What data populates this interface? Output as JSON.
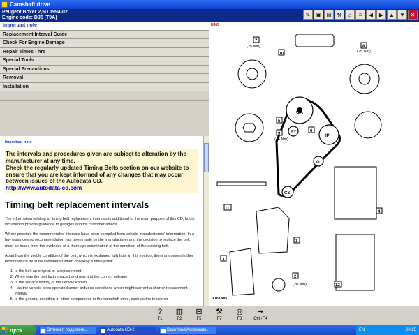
{
  "window": {
    "title": "Camshaft drive"
  },
  "header": {
    "vehicle": "Peugeot   Boxer 2,5D   1994-02",
    "engine": "Engine code: DJ5 (T9A)"
  },
  "toolbar": {
    "icons": [
      "notes-icon",
      "lock-icon",
      "print-icon",
      "tools-icon",
      "home-icon",
      "list-icon",
      "back-icon",
      "forward-icon",
      "up-icon",
      "down-icon",
      "close-icon"
    ]
  },
  "menu": {
    "items": [
      "Important note",
      "Replacement Interval Guide",
      "Check For Engine Damage",
      "Repair Times - hrs",
      "Special Tools",
      "Special Precautions",
      "Removal",
      "Installation"
    ]
  },
  "content": {
    "section_label": "Important note",
    "notice_1": "The intervals and procedures given are subject to alteration by the manufacturer at any time.",
    "notice_2": "Check the regularly updated Timing Belts section on our website to ensure that you are kept informed of any changes that may occur between issues of the Autodata CD.",
    "link": "http://www.autodata-cd.com",
    "heading": "Timing belt replacement intervals",
    "para_1": "The information relating to timing belt replacement intervals is additional to the main purpose of this CD, but is included to provide guidance to garages and for customer advice.",
    "para_2": "Where possible the recommended intervals have been compiled from vehicle manufacturers' information. In a few instances no recommendation has been made by the manufacturer and the decision to replace the belt must be made from the evidence of a thorough examination of the condition of the existing belt.",
    "para_3": "Apart from the visible condition of the belt, which is explained fully later in this section, there are several other factors which must be considered when checking a timing belt:",
    "list": [
      "Is the belt an original or a replacement",
      "When was the belt last replaced and was it at the correct mileage",
      "Is the service history of the vehicle known",
      "Has the vehicle been operated under arduous conditions which might warrant a shorter replacement interval",
      "Is the general condition of other components in the camshaft drive, such as the tensioner"
    ]
  },
  "diagram": {
    "ref_top": "H365",
    "ref_bottom": "AD90985",
    "torque_7": "(25 Nm)",
    "torque_8": "(25 Nm)",
    "torque_9": "(45 Nm)",
    "torque_2": "(20 Nm)",
    "labels": {
      "ca": "CA",
      "bt": "BT",
      "ip": "IP",
      "g": "G",
      "cs": "CS",
      "n1": "1",
      "n2": "2",
      "n3": "3",
      "n4": "4",
      "n5": "5",
      "n6": "6",
      "n7": "7",
      "n8": "8",
      "n9": "9",
      "n10": "10",
      "n11": "11",
      "n12": "12"
    }
  },
  "fkeys": [
    {
      "label": "F1",
      "icon": "help-icon"
    },
    {
      "label": "F2",
      "icon": "book-icon"
    },
    {
      "label": "F5",
      "icon": "open-book-icon"
    },
    {
      "label": "F7",
      "icon": "tools-icon"
    },
    {
      "label": "F8",
      "icon": "belt-icon"
    },
    {
      "label": "Ctrl+F4",
      "icon": "exit-icon"
    }
  ],
  "taskbar": {
    "start": "пуск",
    "tasks": [
      "Оптимал подключе...",
      "Autodata CD-2",
      "Download Accelerato..."
    ],
    "lang": "EN",
    "time": "20:25"
  }
}
